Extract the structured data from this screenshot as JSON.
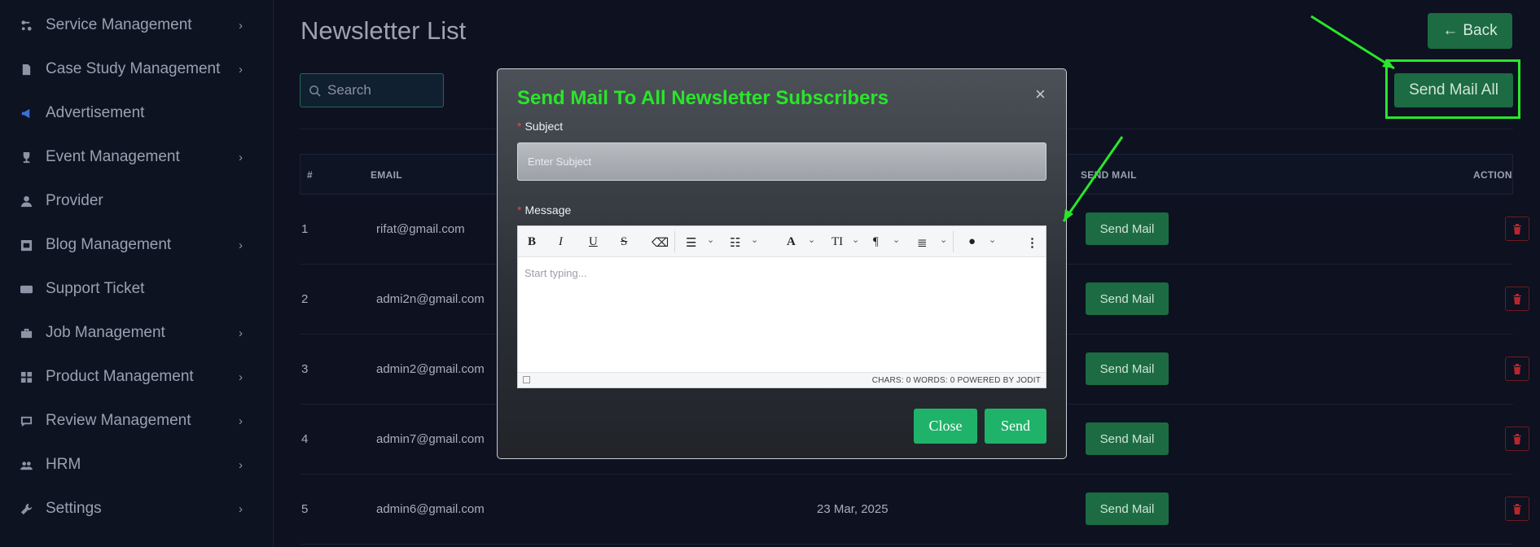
{
  "sidebar": {
    "items": [
      {
        "label": "Service Management",
        "icon": "flow-icon",
        "has_submenu": true
      },
      {
        "label": "Case Study Management",
        "icon": "document-icon",
        "has_submenu": true
      },
      {
        "label": "Advertisement",
        "icon": "megaphone-icon",
        "has_submenu": false
      },
      {
        "label": "Event Management",
        "icon": "trophy-icon",
        "has_submenu": true
      },
      {
        "label": "Provider",
        "icon": "user-icon",
        "has_submenu": false
      },
      {
        "label": "Blog Management",
        "icon": "blog-icon",
        "has_submenu": true
      },
      {
        "label": "Support Ticket",
        "icon": "ticket-icon",
        "has_submenu": false
      },
      {
        "label": "Job Management",
        "icon": "briefcase-icon",
        "has_submenu": true
      },
      {
        "label": "Product Management",
        "icon": "grid-icon",
        "has_submenu": true
      },
      {
        "label": "Review Management",
        "icon": "review-icon",
        "has_submenu": true
      },
      {
        "label": "HRM",
        "icon": "users-icon",
        "has_submenu": true
      },
      {
        "label": "Settings",
        "icon": "wrench-icon",
        "has_submenu": true
      }
    ],
    "chevron": "›"
  },
  "header": {
    "title": "Newsletter List",
    "back_label": "Back",
    "back_icon": "←",
    "send_all_label": "Send Mail All"
  },
  "search": {
    "placeholder": "Search"
  },
  "table": {
    "columns": [
      "#",
      "EMAIL",
      "SEND MAIL",
      "ACTION"
    ],
    "rows": [
      {
        "index": "1",
        "email": "rifat@gmail.com",
        "date": "",
        "send_label": "Send Mail"
      },
      {
        "index": "2",
        "email": "admi2n@gmail.com",
        "date": "",
        "send_label": "Send Mail"
      },
      {
        "index": "3",
        "email": "admin2@gmail.com",
        "date": "",
        "send_label": "Send Mail"
      },
      {
        "index": "4",
        "email": "admin7@gmail.com",
        "date": "",
        "send_label": "Send Mail"
      },
      {
        "index": "5",
        "email": "admin6@gmail.com",
        "date": "23 Mar, 2025",
        "send_label": "Send Mail"
      }
    ]
  },
  "modal": {
    "title": "Send Mail To All Newsletter Subscribers",
    "close_symbol": "×",
    "subject_label": "Subject",
    "subject_placeholder": "Enter Subject",
    "message_label": "Message",
    "required_mark": "*",
    "editor_placeholder": "Start typing...",
    "status": "CHARS: 0   WORDS: 0   POWERED BY JODIT",
    "close_label": "Close",
    "send_label": "Send"
  },
  "colors": {
    "accent_green": "#1c6b43",
    "highlight_green": "#29e629",
    "modal_button": "#1fb36a",
    "danger": "#b8262c"
  }
}
